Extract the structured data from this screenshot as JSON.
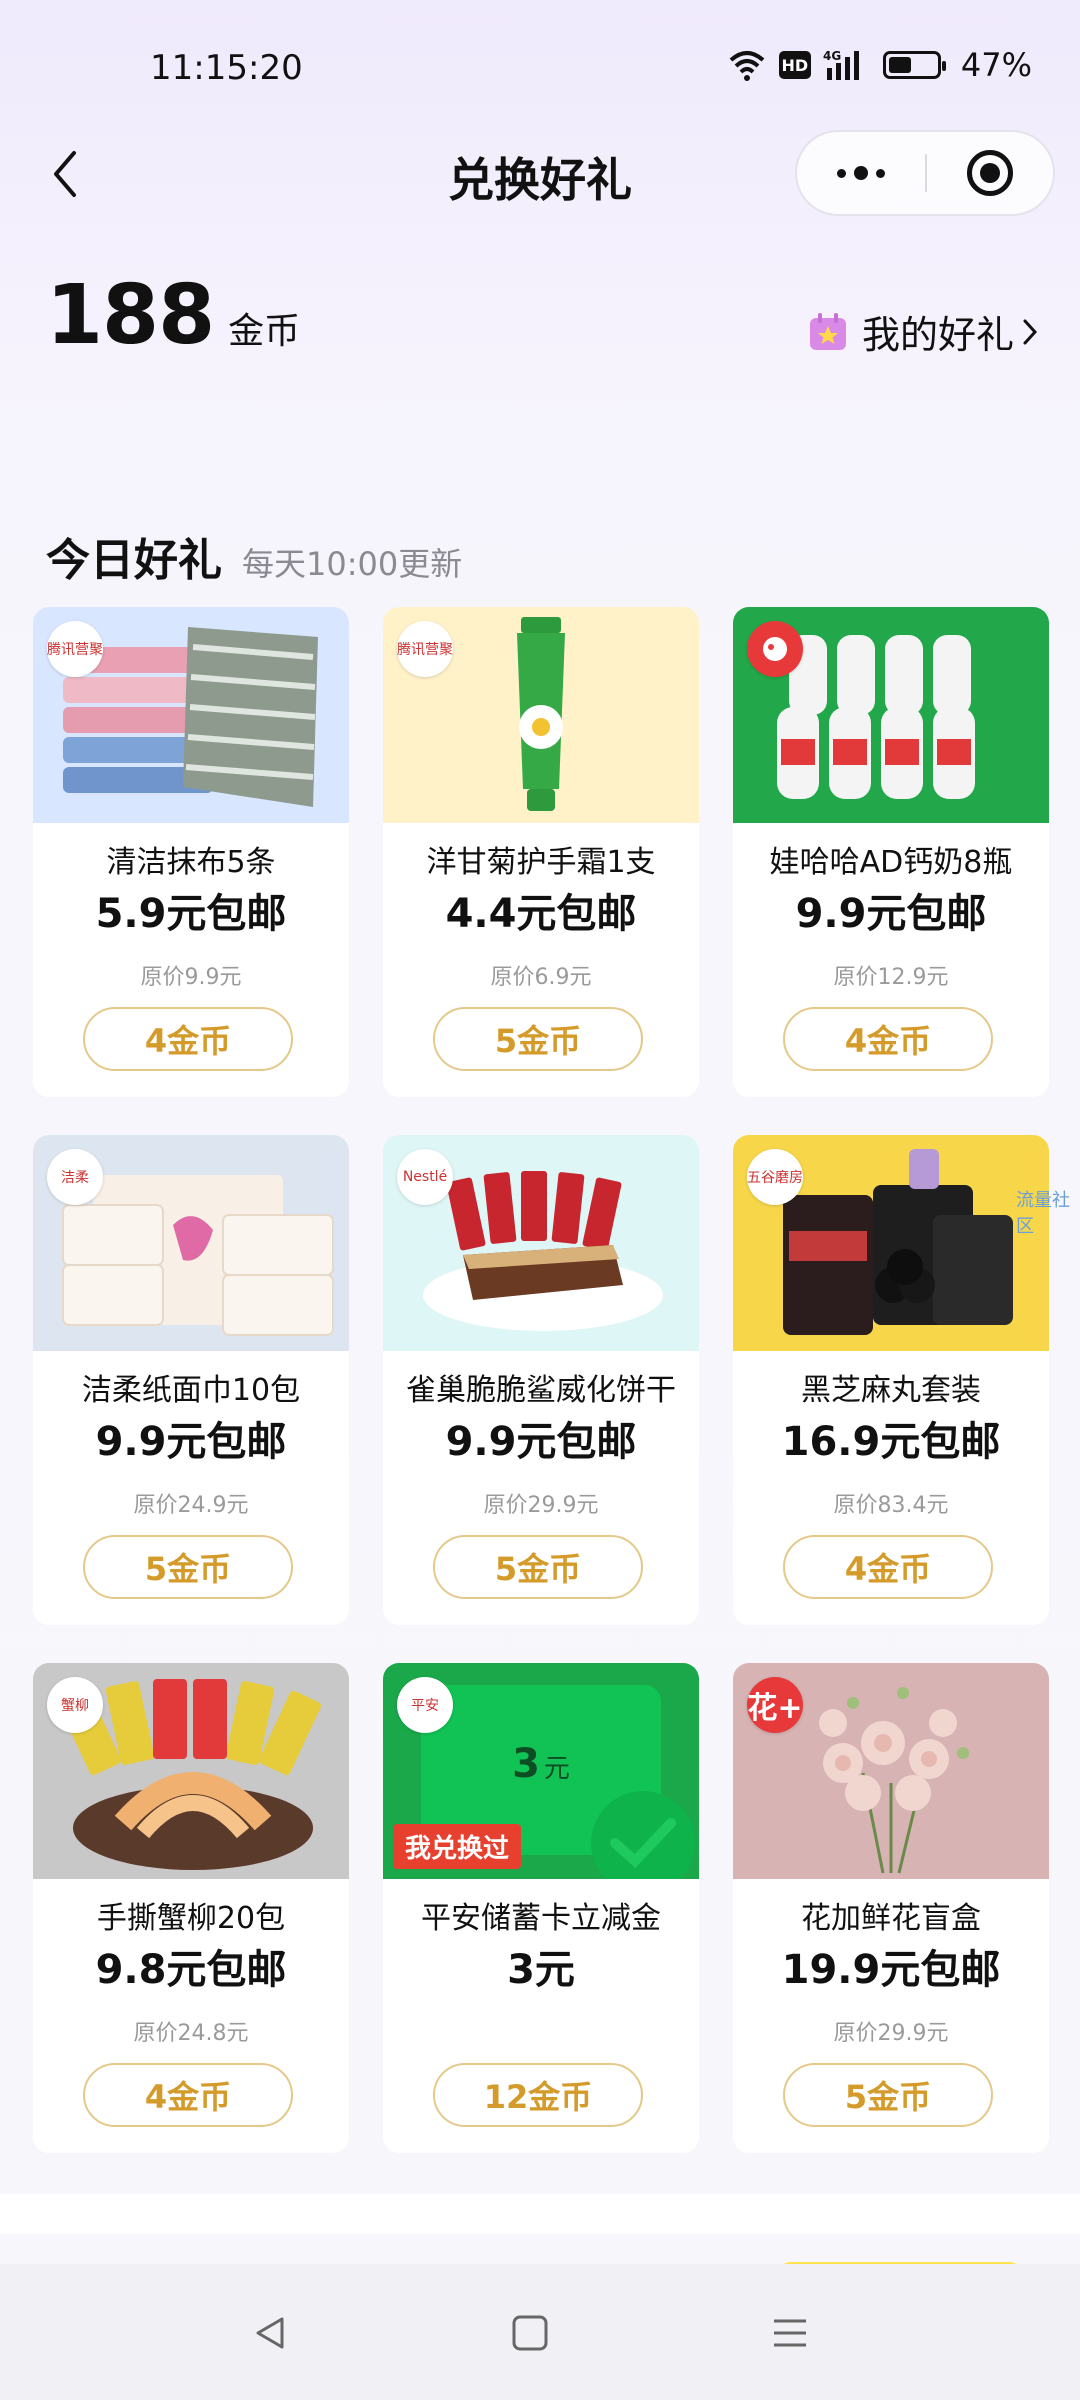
{
  "status_bar": {
    "time": "11:15:20",
    "hd": "HD",
    "network": "4G",
    "battery_percent_text": "47%",
    "battery_level": 0.47
  },
  "nav": {
    "title": "兑换好礼",
    "back_icon": "chevron-left-icon",
    "more_icon": "more-dots-icon",
    "close_icon": "target-close-icon"
  },
  "coins": {
    "amount": "188",
    "unit": "金币"
  },
  "my_gifts": {
    "label": "我的好礼",
    "icon": "gift-calendar-icon"
  },
  "section": {
    "title": "今日好礼",
    "subtitle": "每天10:00更新"
  },
  "products": [
    {
      "name": "清洁抹布5条",
      "price": "5.9元包邮",
      "original": "原价9.9元",
      "cost": "4金币",
      "badge": "腾讯营聚",
      "image": "cloth-towels",
      "bg": "#d8e6ff"
    },
    {
      "name": "洋甘菊护手霜1支",
      "price": "4.4元包邮",
      "original": "原价6.9元",
      "cost": "5金币",
      "badge": "腾讯营聚",
      "image": "hand-cream-tube",
      "bg": "#fff1c8"
    },
    {
      "name": "娃哈哈AD钙奶8瓶",
      "price": "9.9元包邮",
      "original": "原价12.9元",
      "cost": "4金币",
      "badge": "",
      "image": "milk-bottles",
      "bg": "#22a84a"
    },
    {
      "name": "洁柔纸面巾10包",
      "price": "9.9元包邮",
      "original": "原价24.9元",
      "cost": "5金币",
      "badge": "洁柔",
      "image": "tissue-packs",
      "bg": "#dde6f0"
    },
    {
      "name": "雀巢脆脆鲨威化饼干",
      "price": "9.9元包邮",
      "original": "原价29.9元",
      "cost": "5金币",
      "badge": "Nestlé",
      "image": "wafer-bars",
      "bg": "#dff6f6"
    },
    {
      "name": "黑芝麻丸套装",
      "price": "16.9元包邮",
      "original": "原价83.4元",
      "cost": "4金币",
      "badge": "五谷磨房",
      "image": "sesame-balls",
      "bg": "#f7d64a"
    },
    {
      "name": "手撕蟹柳20包",
      "price": "9.8元包邮",
      "original": "原价24.8元",
      "cost": "4金币",
      "badge": "蟹柳",
      "image": "crab-sticks",
      "bg": "#c8c8c8"
    },
    {
      "name": "平安储蓄卡立减金",
      "price": "3元",
      "original": "",
      "cost": "12金币",
      "badge": "平安",
      "image": "voucher-card",
      "bg": "#1aa84a",
      "voucher_text": "3",
      "voucher_unit": "元",
      "tag": "我兑换过"
    },
    {
      "name": "花加鲜花盲盒",
      "price": "19.9元包邮",
      "original": "原价29.9元",
      "cost": "5金币",
      "badge": "花+",
      "image": "flower-bouquet",
      "bg": "#d7b3b3"
    }
  ],
  "watermark": "流量社区",
  "system_nav": {
    "back_icon": "triangle-back-icon",
    "home_icon": "square-home-icon",
    "menu_icon": "menu-lines-icon"
  }
}
